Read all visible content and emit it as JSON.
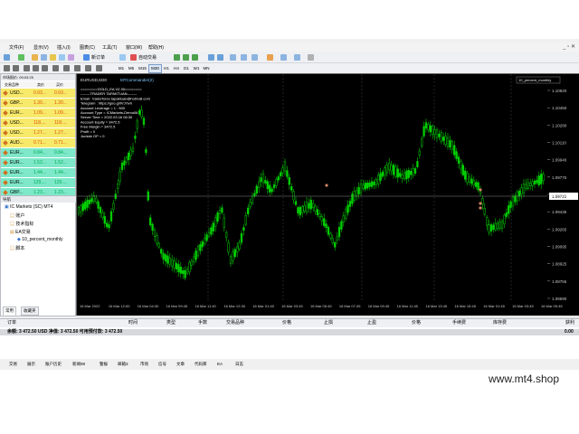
{
  "menu": [
    "文件(F)",
    "显示(V)",
    "插入(I)",
    "图表(C)",
    "工具(T)",
    "窗口(W)",
    "帮助(H)"
  ],
  "toolbar": {
    "new_order": "新订单",
    "autotrade": "自动交易"
  },
  "timeframes": [
    "M1",
    "M5",
    "M15",
    "M30",
    "H1",
    "H4",
    "D1",
    "W1",
    "MN"
  ],
  "active_timeframe": "M30",
  "market_watch": {
    "title": "市场报价: 09:03:25",
    "headers": [
      "交易品种",
      "卖价",
      "买价"
    ],
    "rows": [
      {
        "symbol": "USD...",
        "bid": "0.93...",
        "ask": "0.93...",
        "color": "#f7e96a"
      },
      {
        "symbol": "GBP...",
        "bid": "1.30...",
        "ask": "1.30...",
        "color": "#f7e96a"
      },
      {
        "symbol": "EUR...",
        "bid": "1.09...",
        "ask": "1.09...",
        "color": "#f7e96a"
      },
      {
        "symbol": "USD...",
        "bid": "118....",
        "ask": "118....",
        "color": "#f7e96a"
      },
      {
        "symbol": "USD...",
        "bid": "1.27...",
        "ask": "1.27...",
        "color": "#f7e96a"
      },
      {
        "symbol": "AUD...",
        "bid": "0.71...",
        "ask": "0.71...",
        "color": "#f7e96a"
      },
      {
        "symbol": "EUR...",
        "bid": "0.84...",
        "ask": "0.84...",
        "color": "#7ee8c8"
      },
      {
        "symbol": "EUR...",
        "bid": "1.52...",
        "ask": "1.52...",
        "color": "#7ee8c8"
      },
      {
        "symbol": "EUR...",
        "bid": "1.44...",
        "ask": "1.44...",
        "color": "#7ee8c8"
      },
      {
        "symbol": "EUR...",
        "bid": "129....",
        "ask": "129....",
        "color": "#7ee8c8"
      },
      {
        "symbol": "GBP...",
        "bid": "1.23...",
        "ask": "1.23...",
        "color": "#7ee8c8"
      }
    ],
    "tabs": [
      "交易品种",
      "即时图"
    ]
  },
  "navigator": {
    "title": "导航",
    "items": [
      "IC Markets (SC) MT4",
      "账户",
      "技术指标",
      "EA交易",
      "10_percent_monthly",
      "脚本"
    ],
    "tabs": [
      "常用",
      "收藏夹"
    ]
  },
  "chart": {
    "title": "EURUSD,M30",
    "ea_name": "MTCommander(2)",
    "ea_label": "10_percent_monthly",
    "info_lines": [
      "========GOLD_EA V2.30========",
      "--------TRADER TAPAKTUAN--------",
      "Email : traderforex.tapaktuan@hotmail.com",
      "Telegram : https://goo.gl/tVJ7wh",
      "Account Leverage  =  1 : 500",
      "Account Type      =  ICMarkets-Demo06",
      "Server Time       =  2022.03.16 06:30",
      "Account Equity    =  3472.5",
      "Free Margin       =  3472.5",
      "Profit            =  0",
      "Jumlah OP         =  0"
    ],
    "price_labels": [
      "1.10620",
      "1.10450",
      "1.10280",
      "1.10110",
      "1.09940",
      "1.09775",
      "1.09605",
      "1.09435",
      "1.09265",
      "1.09095",
      "1.08925",
      "1.08755",
      "1.08590"
    ],
    "current_price": "1.09721",
    "time_labels": [
      "16 Mar 2022",
      "16 Mar 12:00",
      "16 Mar 04:30",
      "16 Mar 09:45",
      "16 Mar 11:40",
      "16 Mar 12:30",
      "16 Mar 01:45",
      "16 Mar 03:45",
      "16 Mar 05:45",
      "16 Mar 07:45",
      "16 Mar 09:45",
      "16 Mar 11:45",
      "16 Mar 13:45",
      "16 Mar 15:45",
      "16 Mar 01:45",
      "16 Mar 03:45",
      "16 Mar 05:45"
    ],
    "colors": {
      "bull": "#00e000",
      "bear": "#00e000",
      "background": "#000000",
      "grid": "#555555"
    }
  },
  "terminal": {
    "headers": [
      "订单",
      "时间",
      "类型",
      "手数",
      "交易品种",
      "价格",
      "止损",
      "止盈",
      "价格",
      "手续费",
      "库存费",
      "获利"
    ],
    "balance_text": "余额: 3 472.50 USD  净值: 3 472.50  可用预付款: 3 472.50",
    "profit": "0.00",
    "tabs": [
      "交易",
      "展示",
      "账户历史",
      "新闻99",
      "警报",
      "邮箱3",
      "市场",
      "信号",
      "文章",
      "代码库",
      "EA",
      "日志"
    ]
  },
  "watermark": "www.mt4.shop"
}
